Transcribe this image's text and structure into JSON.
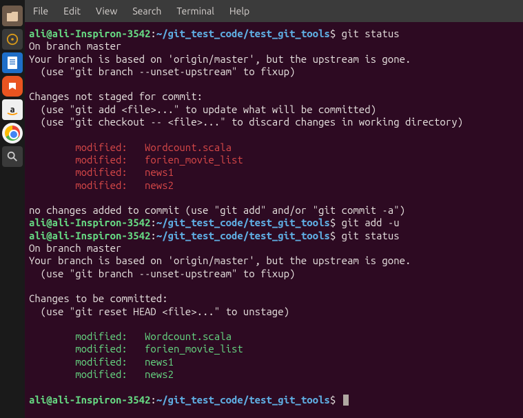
{
  "menubar": {
    "file": "File",
    "edit": "Edit",
    "view": "View",
    "search": "Search",
    "terminal": "Terminal",
    "help": "Help"
  },
  "prompt": {
    "user": "ali@ali-Inspiron-3542",
    "sep": ":",
    "path": "~/git_test_code/test_git_tools",
    "dollar": "$"
  },
  "cmd": {
    "status": " git status",
    "addu": " git add -u"
  },
  "out": {
    "branch": "On branch master",
    "based": "Your branch is based on 'origin/master', but the upstream is gone.",
    "fixup": "  (use \"git branch --unset-upstream\" to fixup)",
    "blank": " ",
    "notstaged": "Changes not staged for commit:",
    "useadd": "  (use \"git add <file>...\" to update what will be committed)",
    "usecheckout": "  (use \"git checkout -- <file>...\" to discard changes in working directory)",
    "mod1": "        modified:   Wordcount.scala",
    "mod2": "        modified:   forien_movie_list",
    "mod3": "        modified:   news1",
    "mod4": "        modified:   news2",
    "nochanges": "no changes added to commit (use \"git add\" and/or \"git commit -a\")",
    "tobecommitted": "Changes to be committed:",
    "usereset": "  (use \"git reset HEAD <file>...\" to unstage)"
  },
  "launcher": {
    "files": "files-icon",
    "rhythm": "rhythmbox-icon",
    "docs": "document-icon",
    "software": "software-center-icon",
    "amazon": "amazon-icon",
    "chrome": "chrome-icon",
    "search": "magnifier-icon"
  }
}
